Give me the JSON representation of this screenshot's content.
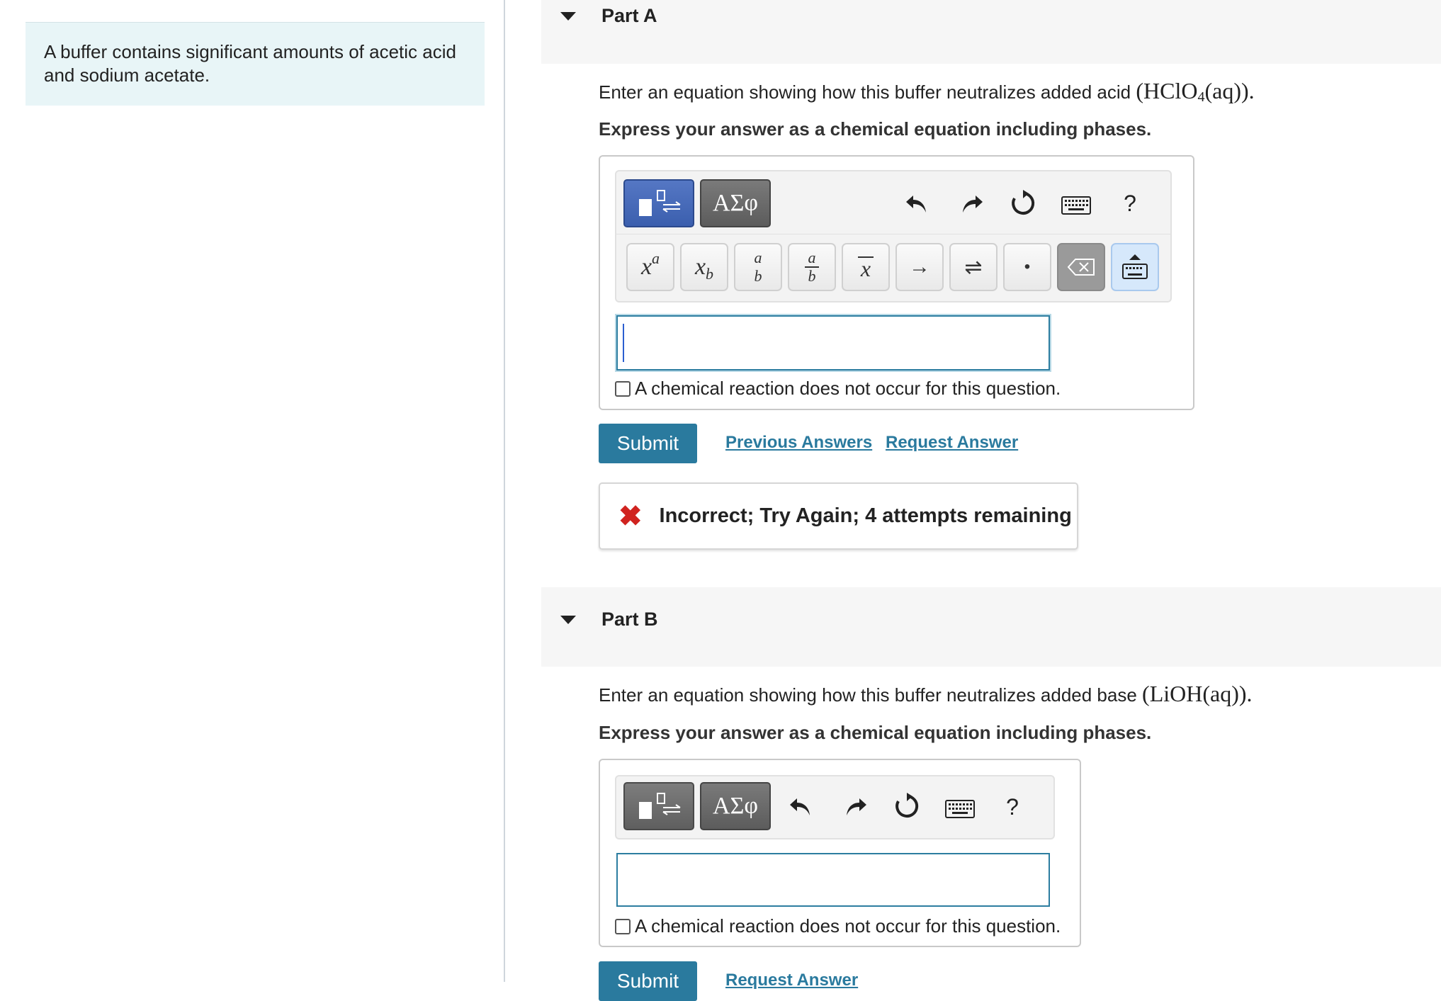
{
  "problem": {
    "text_line1": "A buffer contains significant amounts of acetic acid",
    "text_line2": "and sodium acetate."
  },
  "part_a": {
    "title": "Part A",
    "prompt_text": "Enter an equation showing how this buffer neutralizes added acid ",
    "prompt_chem_pre": "(HClO",
    "prompt_chem_sub": "4",
    "prompt_chem_post": "(aq)).",
    "instruction": "Express your answer as a chemical equation including phases.",
    "greek_label": "ΑΣφ",
    "help_label": "?",
    "keys": [
      "xᵃ",
      "x_b",
      "a/b",
      "a/b",
      "x̄",
      "→",
      "⇌",
      "•",
      "⌫",
      "keyboard"
    ],
    "key_xa_base": "x",
    "key_xa_sup": "a",
    "key_xb_base": "x",
    "key_xb_sub": "b",
    "key_frac_num": "a",
    "key_frac_den": "b",
    "key_xbar": "x",
    "key_arrow": "→",
    "key_equil": "⇌",
    "key_dot": "•",
    "answer_value": "",
    "no_reaction_label": "A chemical reaction does not occur for this question.",
    "submit_label": "Submit",
    "previous_answers_label": "Previous Answers",
    "request_answer_label": "Request Answer",
    "feedback_icon": "✖",
    "feedback_text": "Incorrect; Try Again; 4 attempts remaining"
  },
  "part_b": {
    "title": "Part B",
    "prompt_text": "Enter an equation showing how this buffer neutralizes added base ",
    "prompt_chem": "(LiOH(aq)).",
    "instruction": "Express your answer as a chemical equation including phases.",
    "greek_label": "ΑΣφ",
    "help_label": "?",
    "answer_value": "",
    "no_reaction_label": "A chemical reaction does not occur for this question.",
    "submit_label": "Submit",
    "request_answer_label": "Request Answer"
  },
  "colors": {
    "accent": "#2a7a9e",
    "problem_bg": "#e8f5f7",
    "error": "#d0231f",
    "template_active": "#3b5fae"
  },
  "icons": [
    "caret-down-icon",
    "undo-icon",
    "redo-icon",
    "reset-icon",
    "keyboard-icon",
    "help-icon",
    "backspace-icon",
    "close-x-icon"
  ]
}
